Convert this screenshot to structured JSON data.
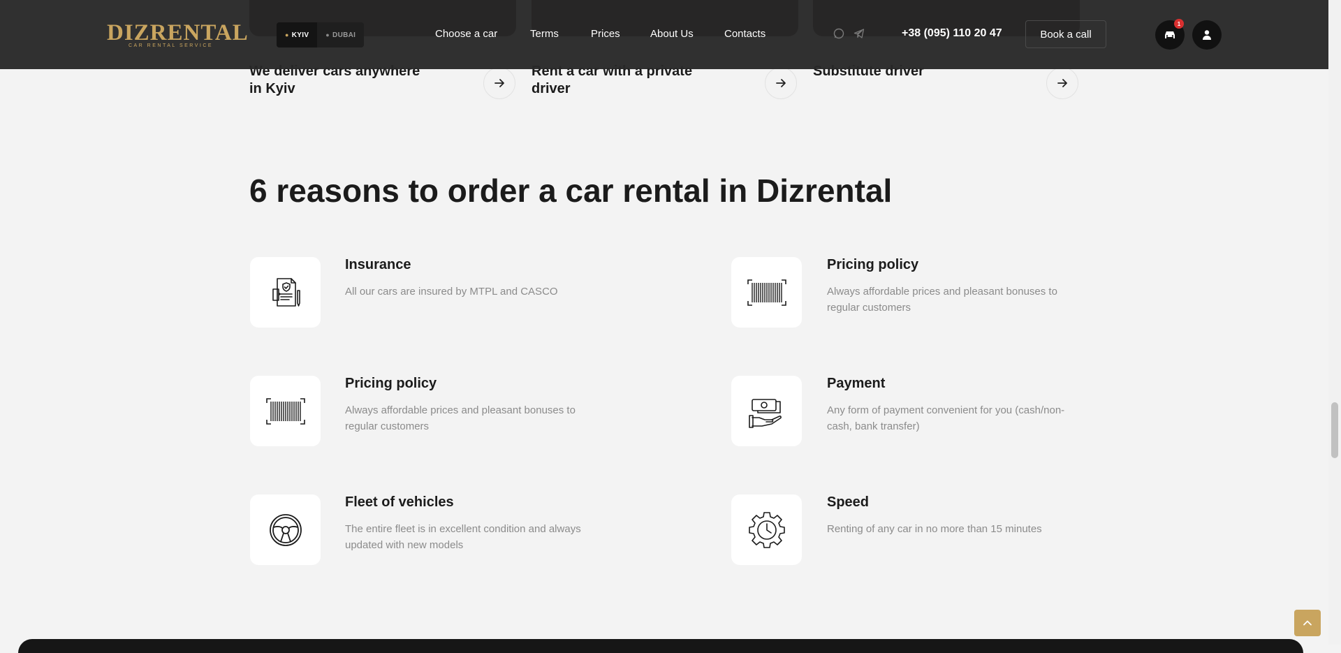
{
  "header": {
    "logo_text": "DIZRENTAL",
    "logo_tagline": "CAR RENTAL SERVICE",
    "cities": [
      {
        "label": "KYIV",
        "active": true
      },
      {
        "label": "DUBAI",
        "active": false
      }
    ],
    "nav": [
      "Choose a car",
      "Terms",
      "Prices",
      "About Us",
      "Contacts"
    ],
    "social_icons": [
      "whatsapp-icon",
      "telegram-icon"
    ],
    "phone": "+38 (095) 110 20 47",
    "book_label": "Book a call",
    "cart_badge": "1"
  },
  "services": [
    {
      "title": "We deliver cars anywhere in Kyiv"
    },
    {
      "title": "Rent a car with a private driver"
    },
    {
      "title": "Substitute driver"
    }
  ],
  "reasons": {
    "title": "6 reasons to order a car rental in Dizrental",
    "items": [
      {
        "title": "Insurance",
        "desc": "All our cars are insured by MTPL and CASCO",
        "icon": "insurance-document-icon"
      },
      {
        "title": "Pricing policy",
        "desc": "Always affordable prices and pleasant bonuses to regular customers",
        "icon": "barcode-icon"
      },
      {
        "title": "Pricing policy",
        "desc": "Always affordable prices and pleasant bonuses to regular customers",
        "icon": "barcode-icon"
      },
      {
        "title": "Payment",
        "desc": "Any form of payment convenient for you (cash/non-cash, bank transfer)",
        "icon": "cash-payment-icon"
      },
      {
        "title": "Fleet of vehicles",
        "desc": "The entire fleet is in excellent condition and always updated with new models",
        "icon": "steering-wheel-icon"
      },
      {
        "title": "Speed",
        "desc": "Renting of any car in no more than 15 minutes",
        "icon": "gear-clock-icon"
      }
    ]
  },
  "colors": {
    "brand_gold": "#c9a55f",
    "header_bg": "#282828",
    "page_bg": "#f3f3f3",
    "badge_red": "#d93030"
  }
}
